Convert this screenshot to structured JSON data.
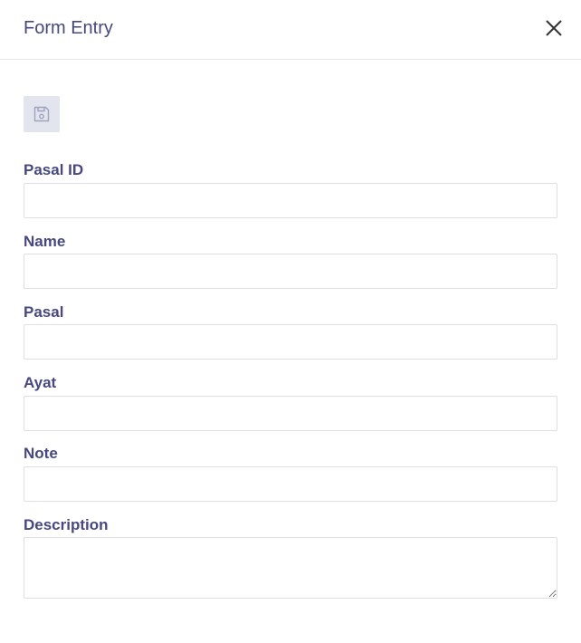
{
  "header": {
    "title": "Form Entry",
    "close_icon": "close-icon"
  },
  "toolbar": {
    "save_icon": "floppy-disk-icon"
  },
  "form": {
    "fields": [
      {
        "label": "Pasal ID",
        "value": "",
        "placeholder": ""
      },
      {
        "label": "Name",
        "value": "",
        "placeholder": ""
      },
      {
        "label": "Pasal",
        "value": "",
        "placeholder": ""
      },
      {
        "label": "Ayat",
        "value": "",
        "placeholder": ""
      },
      {
        "label": "Note",
        "value": "",
        "placeholder": ""
      },
      {
        "label": "Description",
        "value": "",
        "placeholder": ""
      }
    ]
  },
  "colors": {
    "label": "#47487f",
    "border": "#dcdfe6",
    "save_button_bg": "#e3e5ee"
  }
}
